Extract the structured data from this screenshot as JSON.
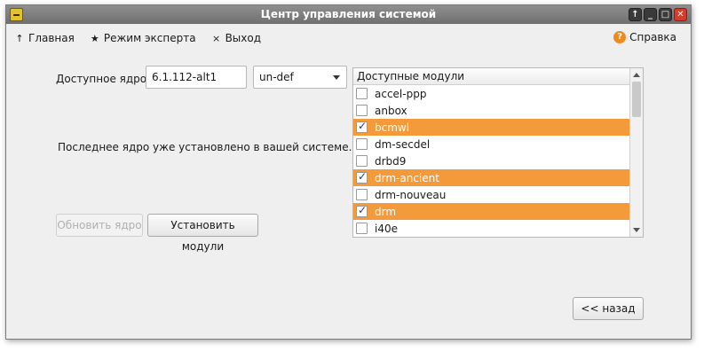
{
  "window": {
    "title": "Центр управления системой",
    "controls": [
      "↑",
      "_",
      "□",
      "✕"
    ]
  },
  "menu": {
    "home": {
      "icon": "↑",
      "label": "Главная"
    },
    "expert": {
      "icon": "★",
      "label": "Режим эксперта"
    },
    "exit": {
      "icon": "×",
      "label": "Выход"
    },
    "help": {
      "icon": "?",
      "label": "Справка"
    }
  },
  "kernel": {
    "label": "Доступное ядро:",
    "version": "6.1.112-alt1",
    "flavour": "un-def"
  },
  "status_text": "Последнее ядро уже установлено в вашей системе.",
  "buttons": {
    "update": "Обновить ядро",
    "install": "Установить модули",
    "back": "<< назад"
  },
  "modules": {
    "header": "Доступные модули",
    "items": [
      {
        "name": "accel-ppp",
        "checked": false
      },
      {
        "name": "anbox",
        "checked": false
      },
      {
        "name": "bcmwl",
        "checked": true
      },
      {
        "name": "dm-secdel",
        "checked": false
      },
      {
        "name": "drbd9",
        "checked": false
      },
      {
        "name": "drm-ancient",
        "checked": true
      },
      {
        "name": "drm-nouveau",
        "checked": false
      },
      {
        "name": "drm",
        "checked": true
      },
      {
        "name": "i40e",
        "checked": false
      }
    ]
  },
  "colors": {
    "selected_row": "#f59a3b",
    "help_icon": "#f08a1e",
    "close_button": "#d63a2a"
  }
}
